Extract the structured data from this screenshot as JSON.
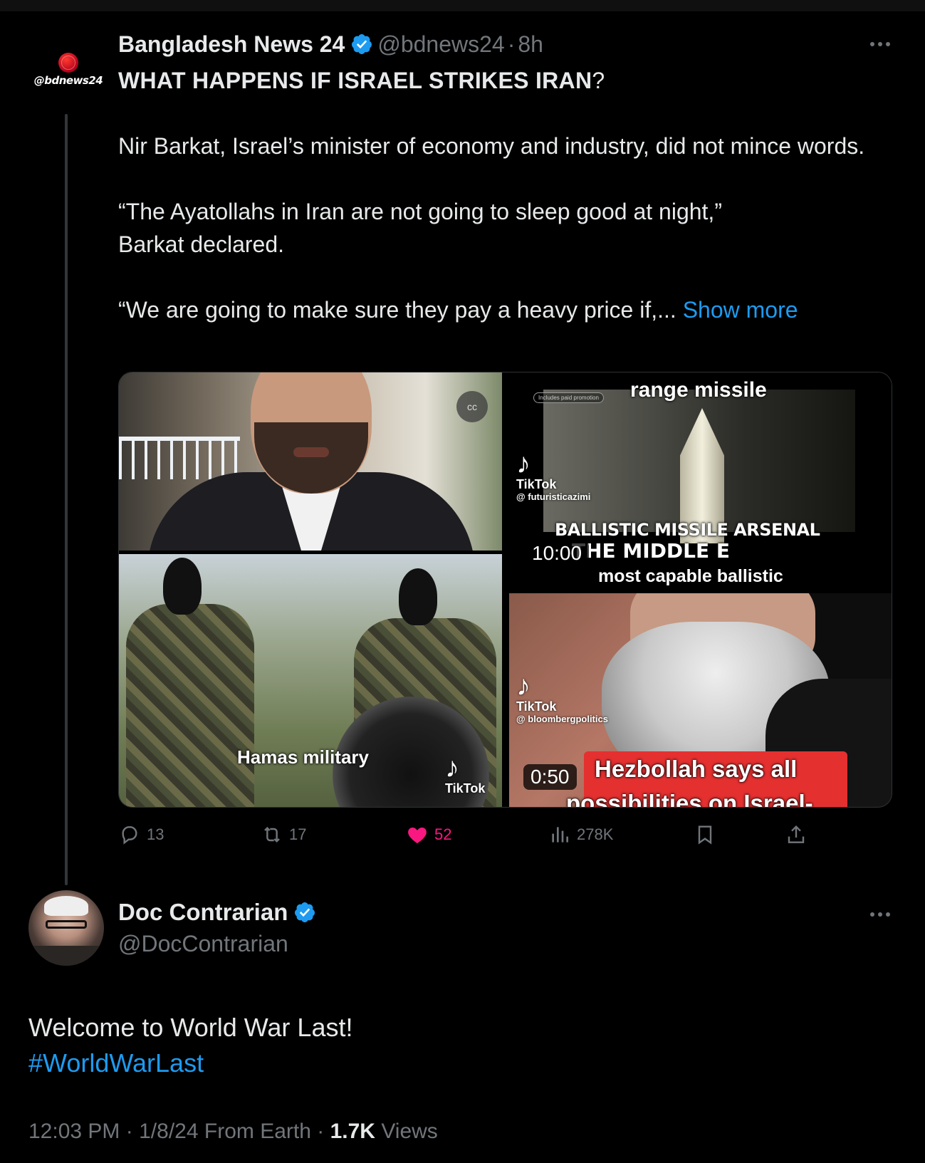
{
  "quoted_tweet": {
    "avatar_brand": "@bdnews24",
    "display_name": "Bangladesh News 24",
    "handle": "@bdnews24",
    "separator": "·",
    "time": "8h",
    "headline": "WHAT HAPPENS IF ISRAEL STRIKES IRAN",
    "headline_suffix": "?",
    "paragraph1": "Nir Barkat, Israel’s minister of economy and industry, did not mince words.",
    "paragraph2_line1": "“The Ayatollahs in Iran are not going to sleep good at night,”",
    "paragraph2_line2": "Barkat declared.",
    "paragraph3": "“We are going to make sure they pay a heavy price if,... ",
    "show_more": "Show more",
    "media": {
      "tile1": {
        "cc_label": "cc"
      },
      "tile2": {
        "caption": "Hamas military",
        "tiktok": "TikTok"
      },
      "tile3": {
        "promo": "Includes paid promotion",
        "top_text": "range missile",
        "tiktok": "TikTok",
        "tiktok_user": "@ futuristicazimi",
        "overlay1": "BALLISTIC MISSILE ARSENAL",
        "overlay2": "THE MIDDLE E",
        "overlay3": "most capable ballistic",
        "duration": "10:00"
      },
      "tile4": {
        "tiktok": "TikTok",
        "tiktok_user": "@ bloombergpolitics",
        "banner1": "Hezbollah says all",
        "banner2": "possibilities on Israel-",
        "duration": "0:50"
      }
    },
    "actions": {
      "replies": "13",
      "reposts": "17",
      "likes": "52",
      "views": "278K"
    },
    "colors": {
      "like": "#f91880",
      "link": "#1d9bf0",
      "verified": "#1d9bf0"
    }
  },
  "main_tweet": {
    "display_name": "Doc Contrarian",
    "handle": "@DocContrarian",
    "text": "Welcome to World War Last!",
    "hashtag": "#WorldWarLast",
    "time": "12:03 PM",
    "date": "1/8/24",
    "source": "From Earth",
    "views_count": "1.7K",
    "views_label": "Views",
    "separator": "·"
  }
}
